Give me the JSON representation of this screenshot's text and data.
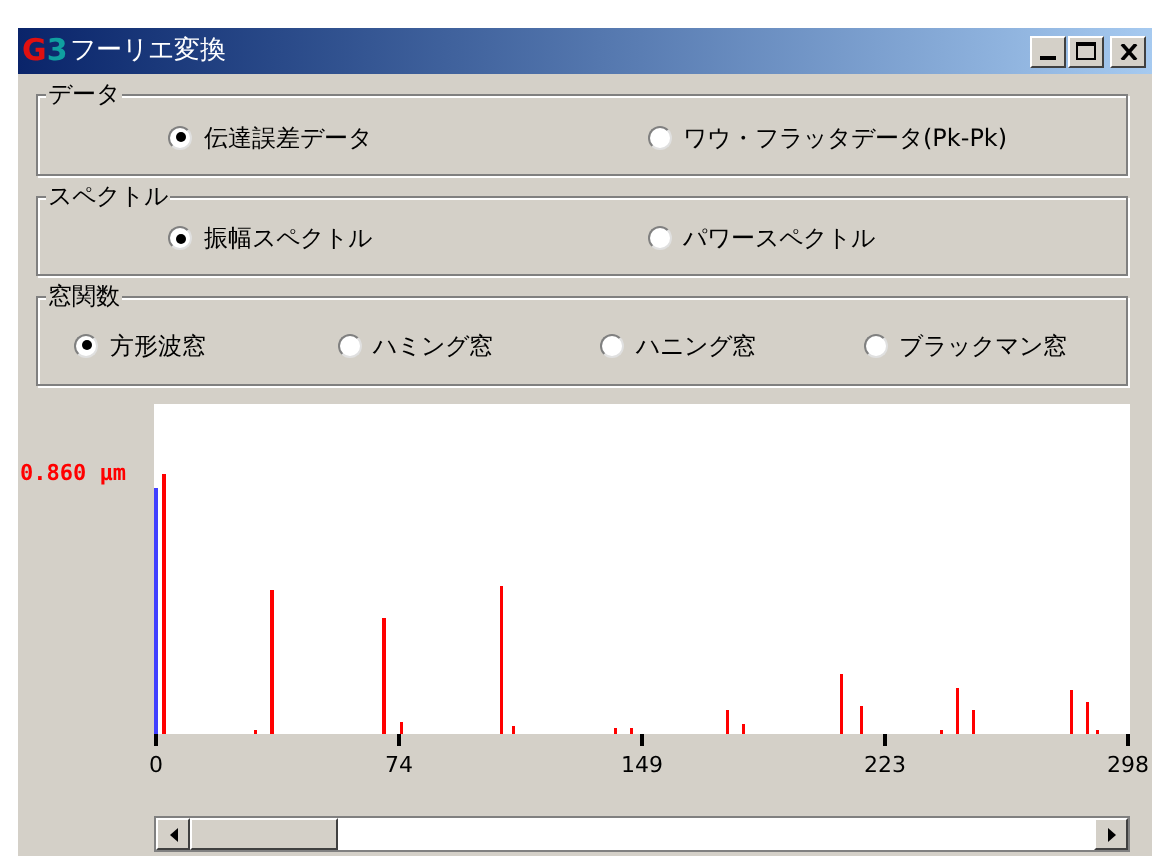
{
  "window": {
    "logo": "G3",
    "title": "フーリエ変換"
  },
  "groups": [
    {
      "label": "データ",
      "options": [
        {
          "label": "伝達誤差データ",
          "selected": true
        },
        {
          "label": "ワウ・フラッタデータ(Pk-Pk)",
          "selected": false
        }
      ]
    },
    {
      "label": "スペクトル",
      "options": [
        {
          "label": "振幅スペクトル",
          "selected": true
        },
        {
          "label": "パワースペクトル",
          "selected": false
        }
      ]
    },
    {
      "label": "窓関数",
      "options": [
        {
          "label": "方形波窓",
          "selected": true
        },
        {
          "label": "ハミング窓",
          "selected": false
        },
        {
          "label": "ハニング窓",
          "selected": false
        },
        {
          "label": "ブラックマン窓",
          "selected": false
        }
      ]
    }
  ],
  "spectrum": {
    "y_max_label": "0.860 μm",
    "x_tick_labels": [
      "0",
      "74",
      "149",
      "223",
      "298"
    ]
  }
}
